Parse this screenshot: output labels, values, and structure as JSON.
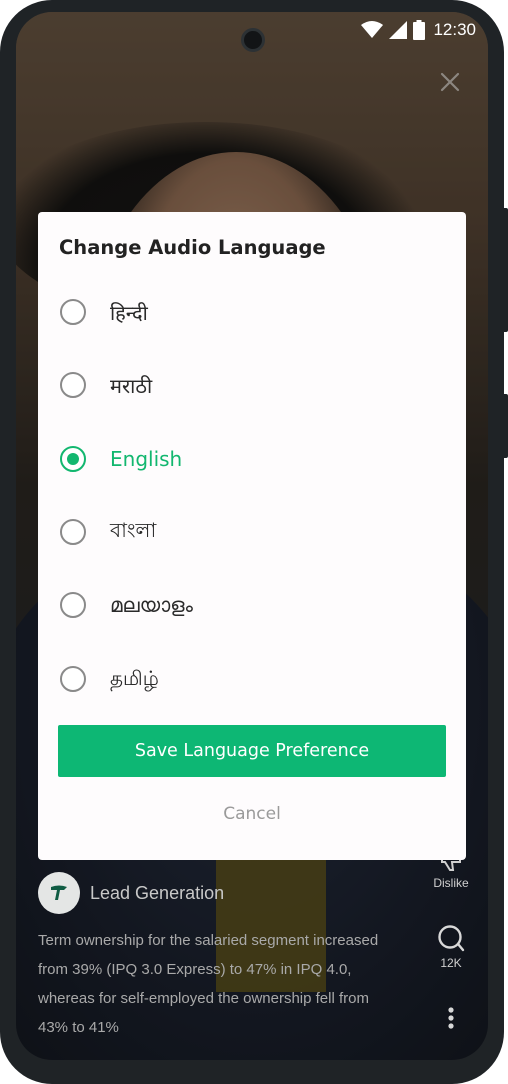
{
  "status_bar": {
    "time": "12:30"
  },
  "creator": {
    "name": "Lead Generation"
  },
  "caption": "Term ownership for the salaried segment increased from 39% (IPQ 3.0 Express) to 47% in IPQ 4.0, whereas for self-employed the ownership fell from 43% to 41%",
  "actions": {
    "dislike_label": "Dislike",
    "comments_count": "12K"
  },
  "dialog": {
    "title": "Change Audio Language",
    "options": [
      {
        "label": "हिन्दी",
        "selected": false
      },
      {
        "label": "मराठी",
        "selected": false
      },
      {
        "label": "English",
        "selected": true
      },
      {
        "label": "বাংলা",
        "selected": false
      },
      {
        "label": "മലയാളം",
        "selected": false
      },
      {
        "label": "தமிழ்",
        "selected": false
      }
    ],
    "save_label": "Save Language Preference",
    "cancel_label": "Cancel"
  },
  "colors": {
    "accent": "#0db774",
    "selected_text": "#12b76f"
  }
}
